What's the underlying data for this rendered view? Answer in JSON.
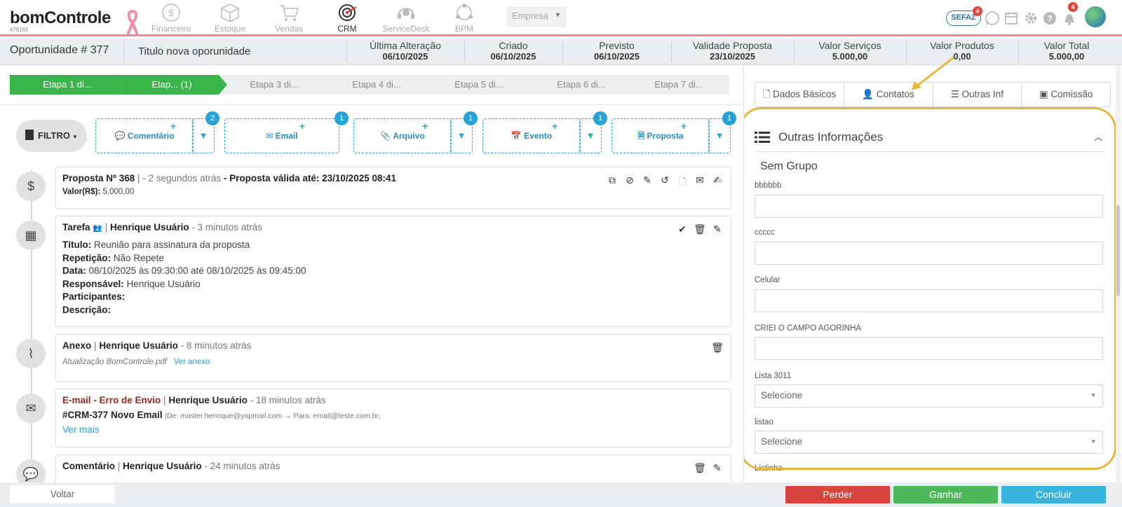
{
  "brand": {
    "logo": "bomControle",
    "account_id": "#76165"
  },
  "modules": [
    {
      "label": "Financeiro",
      "icon": "coin-icon"
    },
    {
      "label": "Estoque",
      "icon": "box-icon"
    },
    {
      "label": "Vendas",
      "icon": "cart-icon"
    },
    {
      "label": "CRM",
      "icon": "target-icon"
    },
    {
      "label": "ServiceDesk",
      "icon": "headset-icon"
    },
    {
      "label": "BPM",
      "icon": "network-icon"
    }
  ],
  "empresa_select": {
    "value": "Empresa"
  },
  "top_right": {
    "sefaz_label": "SEFAZ",
    "sefaz_badge": "4",
    "notif_badge": "4"
  },
  "opportunity": {
    "number_label": "Oportunidade # 377",
    "title": "Titulo nova oporunidade",
    "fields": [
      {
        "label": "Última Alteração",
        "value": "06/10/2025"
      },
      {
        "label": "Criado",
        "value": "06/10/2025"
      },
      {
        "label": "Previsto",
        "value": "06/10/2025"
      },
      {
        "label": "Validade Proposta",
        "value": "23/10/2025"
      },
      {
        "label": "Valor Serviços",
        "value": "5.000,00"
      },
      {
        "label": "Valor Produtos",
        "value": "0,00"
      },
      {
        "label": "Valor Total",
        "value": "5.000,00"
      }
    ]
  },
  "stages": [
    "Etapa 1 di...",
    "Etap... (1)",
    "Etapa 3 di...",
    "Etapa 4 di...",
    "Etapa 5 di...",
    "Etapa 6 di...",
    "Etapa 7 di..."
  ],
  "filter": {
    "label": "FILTRO"
  },
  "actions": [
    {
      "label": "Comentário",
      "count": "2",
      "plus": "+"
    },
    {
      "label": "Email",
      "count": "1",
      "plus": "+"
    },
    {
      "label": "Arquivo",
      "count": "1",
      "plus": "+"
    },
    {
      "label": "Evento",
      "count": "1",
      "plus": "+"
    },
    {
      "label": "Proposta",
      "count": "1",
      "plus": "+"
    }
  ],
  "timeline": {
    "proposta": {
      "title": "Proposta Nº 368",
      "sep": "|",
      "time": "- 2 segundos atrás",
      "validity": "- Proposta válida até: 23/10/2025 08:41",
      "value_label": "Valor(R$):",
      "value": "5.000,00"
    },
    "tarefa": {
      "title": "Tarefa",
      "sep": "|",
      "user": "Henrique Usuário",
      "time": "- 3 minutos atrás",
      "titulo_label": "Título:",
      "titulo": "Reunião para assinatura da proposta",
      "repeticao_label": "Repetição:",
      "repeticao": "Não Repete",
      "data_label": "Data:",
      "data": "08/10/2025 às 09:30:00 até 08/10/2025 às 09:45:00",
      "responsavel_label": "Responsável:",
      "responsavel": "Henrique Usuário",
      "participantes_label": "Participantes:",
      "descricao_label": "Descrição:"
    },
    "anexo": {
      "title": "Anexo",
      "sep": "|",
      "user": "Henrique Usuário",
      "time": "- 8 minutos atrás",
      "file": "Atualização BomControle.pdf",
      "link": "Ver anexo"
    },
    "email": {
      "title": "E-mail - Erro de Envio",
      "sep": "|",
      "user": "Henrique Usuário",
      "time": "- 18 minutos atrás",
      "subject": "#CRM-377 Novo Email",
      "route": "|De: master.henrique@yopmail.com → Para: email@teste.com.br;",
      "link": "Ver mais"
    },
    "comentario": {
      "title": "Comentário",
      "sep": "|",
      "user": "Henrique Usuário",
      "time": "- 24 minutos atrás"
    }
  },
  "right_tabs": [
    "Dados Básicos",
    "Contatos",
    "Outras Inf",
    "Comissão"
  ],
  "outras": {
    "title": "Outras Informações",
    "group": "Sem Grupo",
    "fields": [
      {
        "label": "bbbbbb",
        "value": ""
      },
      {
        "label": "ccccc",
        "value": ""
      },
      {
        "label": "Celular",
        "value": ""
      },
      {
        "label": "CRIEI O CAMPO AGORINHA",
        "value": ""
      }
    ],
    "selects": [
      {
        "label": "Lista 3011",
        "value": "Selecione"
      },
      {
        "label": "listao",
        "value": "Selecione"
      }
    ],
    "next_label": "Listinha"
  },
  "footer": {
    "voltar": "Voltar",
    "perder": "Perder",
    "ganhar": "Ganhar",
    "concluir": "Concluir"
  },
  "colors": {
    "green": "#3ab54a",
    "red": "#d9443f",
    "win": "#4cb85a",
    "done": "#35b3dc",
    "highlight": "#e8b73a",
    "accent": "#29a3d6"
  }
}
